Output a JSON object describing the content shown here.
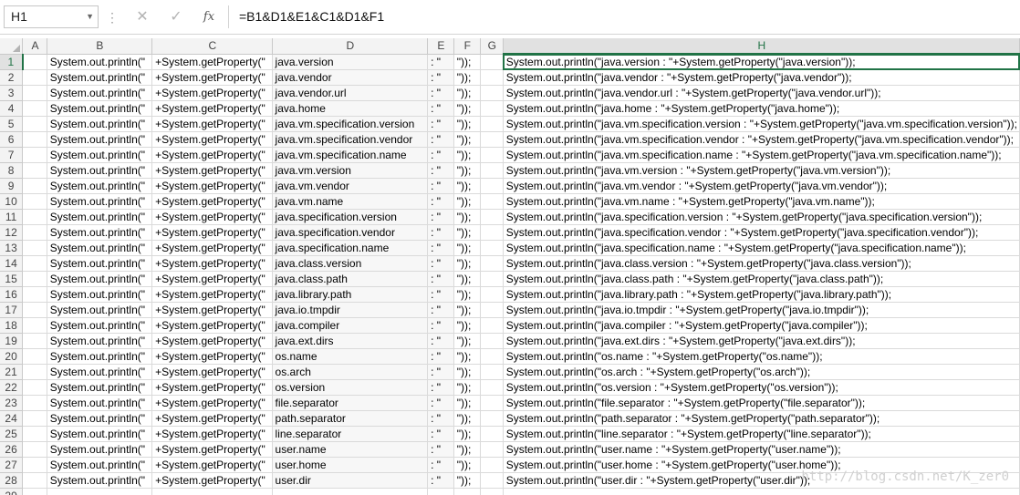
{
  "formula_bar": {
    "name_box": "H1",
    "formula": "=B1&D1&E1&C1&D1&F1",
    "cancel_icon": "✕",
    "enter_icon": "✓",
    "fx_label": "fx"
  },
  "columns": [
    "A",
    "B",
    "C",
    "D",
    "E",
    "F",
    "G",
    "H"
  ],
  "active_column": "H",
  "active_row": 1,
  "col_b": "System.out.println(\"",
  "col_c": "+System.getProperty(\"",
  "col_e": ": \"",
  "col_f": "\"));",
  "rows": [
    {
      "n": "1",
      "d": "java.version",
      "h": "System.out.println(\"java.version : \"+System.getProperty(\"java.version\"));"
    },
    {
      "n": "2",
      "d": "java.vendor",
      "h": "System.out.println(\"java.vendor : \"+System.getProperty(\"java.vendor\"));"
    },
    {
      "n": "3",
      "d": "java.vendor.url",
      "h": "System.out.println(\"java.vendor.url : \"+System.getProperty(\"java.vendor.url\"));"
    },
    {
      "n": "4",
      "d": "java.home",
      "h": "System.out.println(\"java.home : \"+System.getProperty(\"java.home\"));"
    },
    {
      "n": "5",
      "d": "java.vm.specification.version",
      "h": "System.out.println(\"java.vm.specification.version : \"+System.getProperty(\"java.vm.specification.version\"));"
    },
    {
      "n": "6",
      "d": "java.vm.specification.vendor",
      "h": "System.out.println(\"java.vm.specification.vendor : \"+System.getProperty(\"java.vm.specification.vendor\"));"
    },
    {
      "n": "7",
      "d": "java.vm.specification.name",
      "h": "System.out.println(\"java.vm.specification.name : \"+System.getProperty(\"java.vm.specification.name\"));"
    },
    {
      "n": "8",
      "d": "java.vm.version",
      "h": "System.out.println(\"java.vm.version : \"+System.getProperty(\"java.vm.version\"));"
    },
    {
      "n": "9",
      "d": "java.vm.vendor",
      "h": "System.out.println(\"java.vm.vendor : \"+System.getProperty(\"java.vm.vendor\"));"
    },
    {
      "n": "10",
      "d": "java.vm.name",
      "h": "System.out.println(\"java.vm.name : \"+System.getProperty(\"java.vm.name\"));"
    },
    {
      "n": "11",
      "d": "java.specification.version",
      "h": "System.out.println(\"java.specification.version : \"+System.getProperty(\"java.specification.version\"));"
    },
    {
      "n": "12",
      "d": "java.specification.vendor",
      "h": "System.out.println(\"java.specification.vendor : \"+System.getProperty(\"java.specification.vendor\"));"
    },
    {
      "n": "13",
      "d": "java.specification.name",
      "h": "System.out.println(\"java.specification.name : \"+System.getProperty(\"java.specification.name\"));"
    },
    {
      "n": "14",
      "d": "java.class.version",
      "h": "System.out.println(\"java.class.version : \"+System.getProperty(\"java.class.version\"));"
    },
    {
      "n": "15",
      "d": "java.class.path",
      "h": "System.out.println(\"java.class.path : \"+System.getProperty(\"java.class.path\"));"
    },
    {
      "n": "16",
      "d": "java.library.path",
      "h": "System.out.println(\"java.library.path : \"+System.getProperty(\"java.library.path\"));"
    },
    {
      "n": "17",
      "d": "java.io.tmpdir",
      "h": "System.out.println(\"java.io.tmpdir : \"+System.getProperty(\"java.io.tmpdir\"));"
    },
    {
      "n": "18",
      "d": "java.compiler",
      "h": "System.out.println(\"java.compiler : \"+System.getProperty(\"java.compiler\"));"
    },
    {
      "n": "19",
      "d": "java.ext.dirs",
      "h": "System.out.println(\"java.ext.dirs : \"+System.getProperty(\"java.ext.dirs\"));"
    },
    {
      "n": "20",
      "d": "os.name",
      "h": "System.out.println(\"os.name : \"+System.getProperty(\"os.name\"));"
    },
    {
      "n": "21",
      "d": "os.arch",
      "h": "System.out.println(\"os.arch : \"+System.getProperty(\"os.arch\"));"
    },
    {
      "n": "22",
      "d": "os.version",
      "h": "System.out.println(\"os.version : \"+System.getProperty(\"os.version\"));"
    },
    {
      "n": "23",
      "d": "file.separator",
      "h": "System.out.println(\"file.separator : \"+System.getProperty(\"file.separator\"));"
    },
    {
      "n": "24",
      "d": "path.separator",
      "h": "System.out.println(\"path.separator : \"+System.getProperty(\"path.separator\"));"
    },
    {
      "n": "25",
      "d": "line.separator",
      "h": "System.out.println(\"line.separator : \"+System.getProperty(\"line.separator\"));"
    },
    {
      "n": "26",
      "d": "user.name",
      "h": "System.out.println(\"user.name : \"+System.getProperty(\"user.name\"));"
    },
    {
      "n": "27",
      "d": "user.home",
      "h": "System.out.println(\"user.home : \"+System.getProperty(\"user.home\"));"
    },
    {
      "n": "28",
      "d": "user.dir",
      "h": "System.out.println(\"user.dir : \"+System.getProperty(\"user.dir\"));"
    }
  ],
  "last_row_number": "29",
  "watermark": "http://blog.csdn.net/K_zer0",
  "colors": {
    "accent": "#217346",
    "header_bg": "#f3f3f3",
    "gridline": "#dadada"
  }
}
